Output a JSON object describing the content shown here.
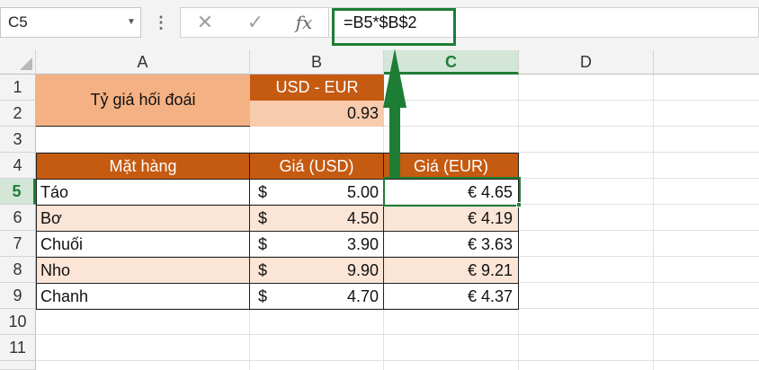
{
  "formula_bar": {
    "name_box": "C5",
    "cancel_icon": "✕",
    "enter_icon": "✓",
    "fx_label": "fx",
    "formula": "=B5*$B$2"
  },
  "columns": [
    "A",
    "B",
    "C",
    "D"
  ],
  "rows": [
    "1",
    "2",
    "3",
    "4",
    "5",
    "6",
    "7",
    "8",
    "9",
    "10",
    "11"
  ],
  "sheet": {
    "title": "Tỷ giá hối đoái",
    "rate_header": "USD - EUR",
    "rate_value": "0.93",
    "table_headers": [
      "Mặt hàng",
      "Giá (USD)",
      "Giá (EUR)"
    ],
    "items": [
      {
        "name": "Táo",
        "currency": "$",
        "usd": "5.00",
        "eur": "€ 4.65"
      },
      {
        "name": "Bơ",
        "currency": "$",
        "usd": "4.50",
        "eur": "€ 4.19"
      },
      {
        "name": "Chuối",
        "currency": "$",
        "usd": "3.90",
        "eur": "€ 3.63"
      },
      {
        "name": "Nho",
        "currency": "$",
        "usd": "9.90",
        "eur": "€ 9.21"
      },
      {
        "name": "Chanh",
        "currency": "$",
        "usd": "4.70",
        "eur": "€ 4.37"
      }
    ]
  },
  "colors": {
    "header_orange": "#c55a11",
    "title_fill": "#f4b183",
    "rate_fill": "#f8cbad",
    "row_alt_fill": "#fbe5d6",
    "excel_green": "#1e7d35"
  }
}
